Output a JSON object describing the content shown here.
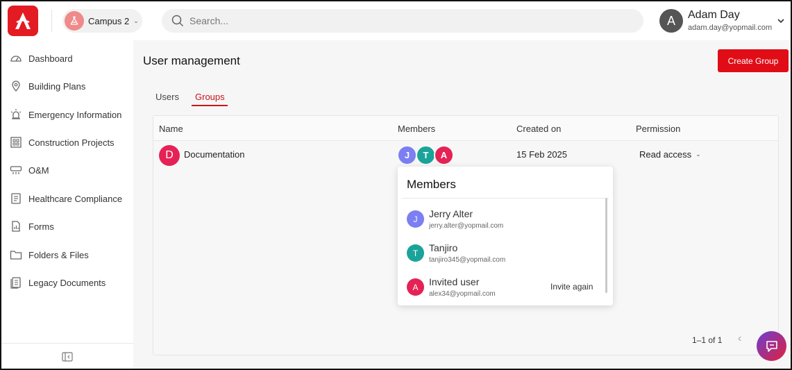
{
  "header": {
    "campus_label": "Campus 2",
    "search_placeholder": "Search...",
    "user_initial": "A",
    "user_name": "Adam Day",
    "user_email": "adam.day@yopmail.com"
  },
  "sidebar": {
    "items": [
      {
        "label": "Dashboard",
        "icon": "gauge-icon"
      },
      {
        "label": "Building Plans",
        "icon": "map-pin-icon"
      },
      {
        "label": "Emergency Information",
        "icon": "alarm-icon"
      },
      {
        "label": "Construction Projects",
        "icon": "building-icon"
      },
      {
        "label": "O&M",
        "icon": "ac-unit-icon"
      },
      {
        "label": "Healthcare Compliance",
        "icon": "checklist-icon"
      },
      {
        "label": "Forms",
        "icon": "form-icon"
      },
      {
        "label": "Folders & Files",
        "icon": "folder-icon"
      },
      {
        "label": "Legacy Documents",
        "icon": "documents-icon"
      }
    ]
  },
  "main": {
    "title": "User management",
    "create_button": "Create Group",
    "tabs": [
      {
        "label": "Users",
        "active": false
      },
      {
        "label": "Groups",
        "active": true
      }
    ],
    "table": {
      "headers": [
        "Name",
        "Members",
        "Created on",
        "Permission"
      ],
      "rows": [
        {
          "initial": "D",
          "name": "Documentation",
          "members": [
            "J",
            "T",
            "A"
          ],
          "created_on": "15 Feb 2025",
          "permission": "Read access"
        }
      ]
    },
    "pagination": "1–1 of 1"
  },
  "members_popover": {
    "title": "Members",
    "members": [
      {
        "initial": "J",
        "name": "Jerry Alter",
        "email": "jerry.alter@yopmail.com",
        "color": "#7b7ff2"
      },
      {
        "initial": "T",
        "name": "Tanjiro",
        "email": "tanjiro345@yopmail.com",
        "color": "#1aa399"
      },
      {
        "initial": "A",
        "name": "Invited user",
        "email": "alex34@yopmail.com",
        "color": "#e52255",
        "action": "Invite again"
      }
    ]
  },
  "colors": {
    "brand_red": "#e00d17",
    "tab_active": "#c8141c"
  }
}
